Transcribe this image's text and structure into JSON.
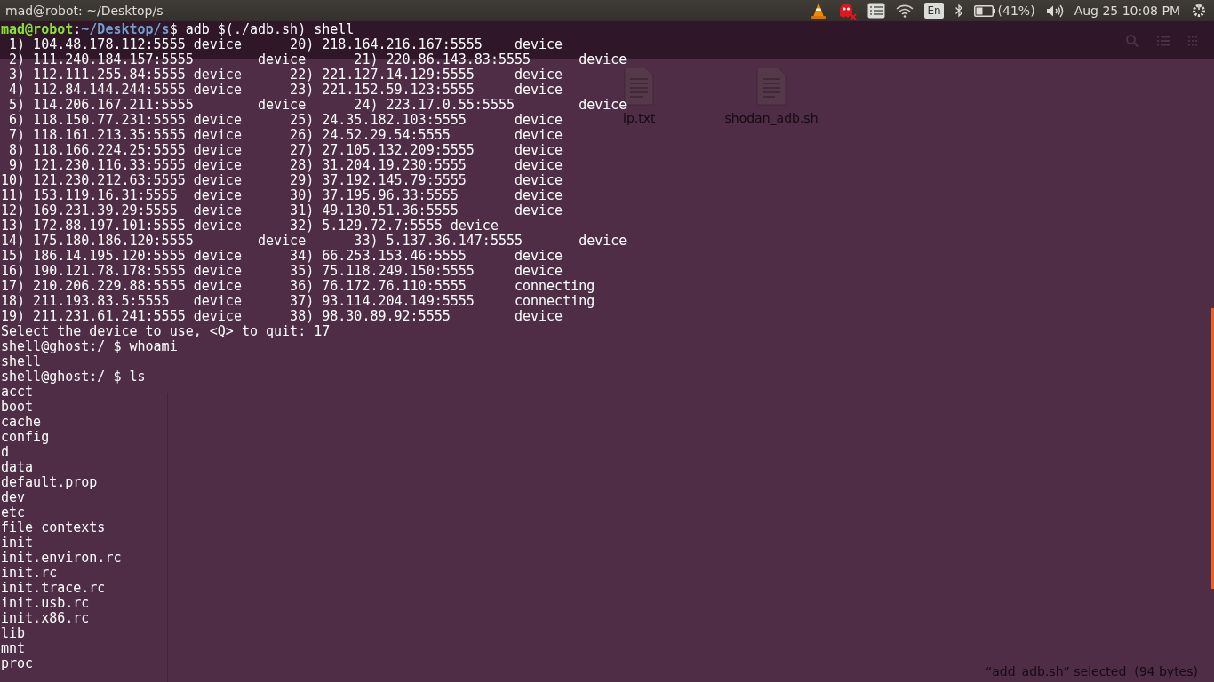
{
  "top_panel": {
    "title": "mad@robot: ~/Desktop/s",
    "keyboard_layout": "En",
    "battery": {
      "reading": "(41%)",
      "level": 0.41
    },
    "clock": "Aug 25 10:08 PM"
  },
  "file_manager": {
    "files": [
      {
        "name": "ip.txt"
      },
      {
        "name": "shodan_adb.sh"
      }
    ],
    "status_bar": "“add_adb.sh” selected  (94 bytes)"
  },
  "terminal": {
    "prompt": [
      {
        "text": "mad@robot",
        "kind": "user"
      },
      {
        "text": ":",
        "kind": "plain"
      },
      {
        "text": "~/Desktop/s",
        "kind": "path"
      },
      {
        "text": "$ adb $(./adb.sh) shell",
        "kind": "plain"
      }
    ],
    "lines": [
      " 1) 104.48.178.112:5555 device      20) 218.164.216.167:5555    device",
      " 2) 111.240.184.157:5555        device      21) 220.86.143.83:5555      device",
      " 3) 112.111.255.84:5555 device      22) 221.127.14.129:5555     device",
      " 4) 112.84.144.244:5555 device      23) 221.152.59.123:5555     device",
      " 5) 114.206.167.211:5555        device      24) 223.17.0.55:5555        device",
      " 6) 118.150.77.231:5555 device      25) 24.35.182.103:5555      device",
      " 7) 118.161.213.35:5555 device      26) 24.52.29.54:5555        device",
      " 8) 118.166.224.25:5555 device      27) 27.105.132.209:5555     device",
      " 9) 121.230.116.33:5555 device      28) 31.204.19.230:5555      device",
      "10) 121.230.212.63:5555 device      29) 37.192.145.79:5555      device",
      "11) 153.119.16.31:5555  device      30) 37.195.96.33:5555       device",
      "12) 169.231.39.29:5555  device      31) 49.130.51.36:5555       device",
      "13) 172.88.197.101:5555 device      32) 5.129.72.7:5555 device",
      "14) 175.180.186.120:5555        device      33) 5.137.36.147:5555       device",
      "15) 186.14.195.120:5555 device      34) 66.253.153.46:5555      device",
      "16) 190.121.78.178:5555 device      35) 75.118.249.150:5555     device",
      "17) 210.206.229.88:5555 device      36) 76.172.76.110:5555      connecting",
      "18) 211.193.83.5:5555   device      37) 93.114.204.149:5555     connecting",
      "19) 211.231.61.241:5555 device      38) 98.30.89.92:5555        device",
      "Select the device to use, <Q> to quit: 17",
      "shell@ghost:/ $ whoami",
      "shell",
      "shell@ghost:/ $ ls",
      "acct",
      "boot",
      "cache",
      "config",
      "d",
      "data",
      "default.prop",
      "dev",
      "etc",
      "file_contexts",
      "init",
      "init.environ.rc",
      "init.rc",
      "init.trace.rc",
      "init.usb.rc",
      "init.x86.rc",
      "lib",
      "mnt",
      "proc"
    ]
  }
}
